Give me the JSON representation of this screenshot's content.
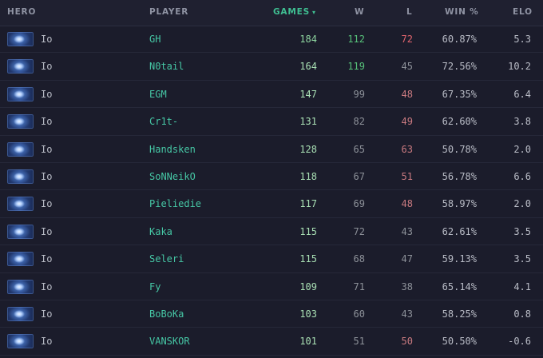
{
  "columns": {
    "hero": "HERO",
    "player": "PLAYER",
    "games": "GAMES",
    "games_sort_indicator": "▾",
    "wins": "W",
    "losses": "L",
    "winrate": "WIN %",
    "elo": "ELO"
  },
  "colors": {
    "background": "#1b1c2b",
    "header_background": "#1f2030",
    "accent_green": "#3fbf92",
    "player_teal": "#46c7a5",
    "win_green": "#57c27a",
    "loss_red": "#e0646d"
  },
  "rows": [
    {
      "hero": "Io",
      "hero_icon": "io-hero-portrait",
      "player": "GH",
      "games": "184",
      "wins": "112",
      "losses": "72",
      "winrate": "60.87%",
      "elo": "5.3"
    },
    {
      "hero": "Io",
      "hero_icon": "io-hero-portrait",
      "player": "N0tail",
      "games": "164",
      "wins": "119",
      "losses": "45",
      "winrate": "72.56%",
      "elo": "10.2"
    },
    {
      "hero": "Io",
      "hero_icon": "io-hero-portrait",
      "player": "EGM",
      "games": "147",
      "wins": "99",
      "losses": "48",
      "winrate": "67.35%",
      "elo": "6.4"
    },
    {
      "hero": "Io",
      "hero_icon": "io-hero-portrait",
      "player": "Cr1t-",
      "games": "131",
      "wins": "82",
      "losses": "49",
      "winrate": "62.60%",
      "elo": "3.8"
    },
    {
      "hero": "Io",
      "hero_icon": "io-hero-portrait",
      "player": "Handsken",
      "games": "128",
      "wins": "65",
      "losses": "63",
      "winrate": "50.78%",
      "elo": "2.0"
    },
    {
      "hero": "Io",
      "hero_icon": "io-hero-portrait",
      "player": "SoNNeikO",
      "games": "118",
      "wins": "67",
      "losses": "51",
      "winrate": "56.78%",
      "elo": "6.6"
    },
    {
      "hero": "Io",
      "hero_icon": "io-hero-portrait",
      "player": "Pieliedie",
      "games": "117",
      "wins": "69",
      "losses": "48",
      "winrate": "58.97%",
      "elo": "2.0"
    },
    {
      "hero": "Io",
      "hero_icon": "io-hero-portrait",
      "player": "Kaka",
      "games": "115",
      "wins": "72",
      "losses": "43",
      "winrate": "62.61%",
      "elo": "3.5"
    },
    {
      "hero": "Io",
      "hero_icon": "io-hero-portrait",
      "player": "Seleri",
      "games": "115",
      "wins": "68",
      "losses": "47",
      "winrate": "59.13%",
      "elo": "3.5"
    },
    {
      "hero": "Io",
      "hero_icon": "io-hero-portrait",
      "player": "Fy",
      "games": "109",
      "wins": "71",
      "losses": "38",
      "winrate": "65.14%",
      "elo": "4.1"
    },
    {
      "hero": "Io",
      "hero_icon": "io-hero-portrait",
      "player": "BoBoKa",
      "games": "103",
      "wins": "60",
      "losses": "43",
      "winrate": "58.25%",
      "elo": "0.8"
    },
    {
      "hero": "Io",
      "hero_icon": "io-hero-portrait",
      "player": "VANSKOR",
      "games": "101",
      "wins": "51",
      "losses": "50",
      "winrate": "50.50%",
      "elo": "-0.6"
    }
  ]
}
